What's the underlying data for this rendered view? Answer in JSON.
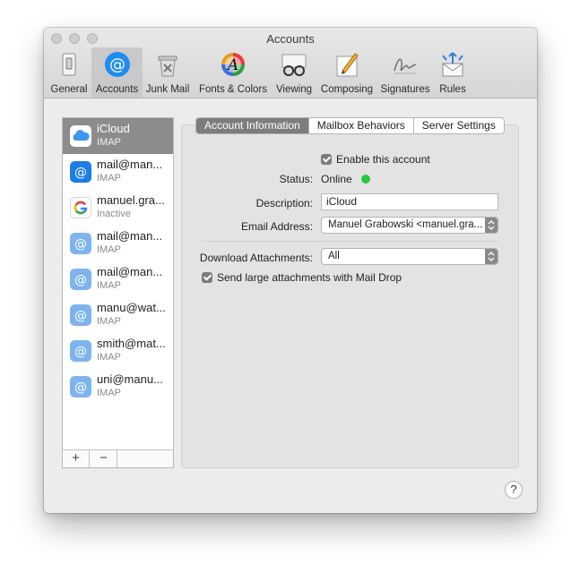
{
  "window": {
    "title": "Accounts"
  },
  "toolbar": {
    "items": [
      {
        "label": "General"
      },
      {
        "label": "Accounts"
      },
      {
        "label": "Junk Mail"
      },
      {
        "label": "Fonts & Colors"
      },
      {
        "label": "Viewing"
      },
      {
        "label": "Composing"
      },
      {
        "label": "Signatures"
      },
      {
        "label": "Rules"
      }
    ],
    "selected": "Accounts"
  },
  "accounts": [
    {
      "name": "iCloud",
      "type": "IMAP",
      "icon": "icloud-icon"
    },
    {
      "name": "mail@man...",
      "type": "IMAP",
      "icon": "at-icon"
    },
    {
      "name": "manuel.gra...",
      "type": "Inactive",
      "icon": "google-icon"
    },
    {
      "name": "mail@man...",
      "type": "IMAP",
      "icon": "at-icon"
    },
    {
      "name": "mail@man...",
      "type": "IMAP",
      "icon": "at-icon"
    },
    {
      "name": "manu@wat...",
      "type": "IMAP",
      "icon": "at-icon"
    },
    {
      "name": "smith@mat...",
      "type": "IMAP",
      "icon": "at-icon"
    },
    {
      "name": "uni@manu...",
      "type": "IMAP",
      "icon": "at-icon"
    }
  ],
  "sidebar_buttons": {
    "add": "+",
    "remove": "−"
  },
  "tabs": [
    "Account Information",
    "Mailbox Behaviors",
    "Server Settings"
  ],
  "form": {
    "enable_label": "Enable this account",
    "status_label": "Status:",
    "status_value": "Online",
    "description_label": "Description:",
    "description_value": "iCloud",
    "email_label": "Email Address:",
    "email_value": "Manuel Grabowski <manuel.gra...",
    "download_label": "Download Attachments:",
    "download_value": "All",
    "maildrop_label": "Send large attachments with Mail Drop"
  },
  "help": "?",
  "colors": {
    "online": "#28c840",
    "accent": "#1a73e8"
  }
}
